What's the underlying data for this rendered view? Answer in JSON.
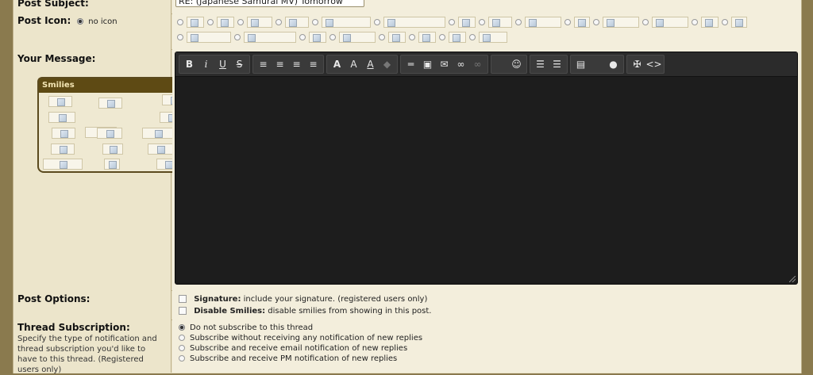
{
  "subject": {
    "label": "Post Subject:",
    "value": "RE: (Japanese Samurai MV) Tomorrow"
  },
  "post_icon": {
    "label": "Post Icon:",
    "no_icon": "no icon"
  },
  "message": {
    "label": "Your Message:"
  },
  "smilies": {
    "title": "Smilies"
  },
  "toolbar": {
    "bold": "B",
    "italic": "i",
    "underline": "U",
    "strike": "S",
    "font": "A",
    "size": "A",
    "color": "A",
    "smiley": "☺",
    "code": "<>"
  },
  "post_options": {
    "label": "Post Options:",
    "signature_bold": "Signature:",
    "signature_text": "include your signature. (registered users only)",
    "smilies_bold": "Disable Smilies:",
    "smilies_text": "disable smilies from showing in this post."
  },
  "subscription": {
    "label": "Thread Subscription:",
    "description": "Specify the type of notification and thread subscription you'd like to have to this thread. (Registered users only)",
    "options": [
      "Do not subscribe to this thread",
      "Subscribe without receiving any notification of new replies",
      "Subscribe and receive email notification of new replies",
      "Subscribe and receive PM notification of new replies"
    ]
  },
  "colors": {
    "page_bg": "#8a7a4e",
    "panel": "#e9e2c7",
    "editor_bg": "#1d1d1d",
    "smilies_header": "#5e4a14"
  }
}
